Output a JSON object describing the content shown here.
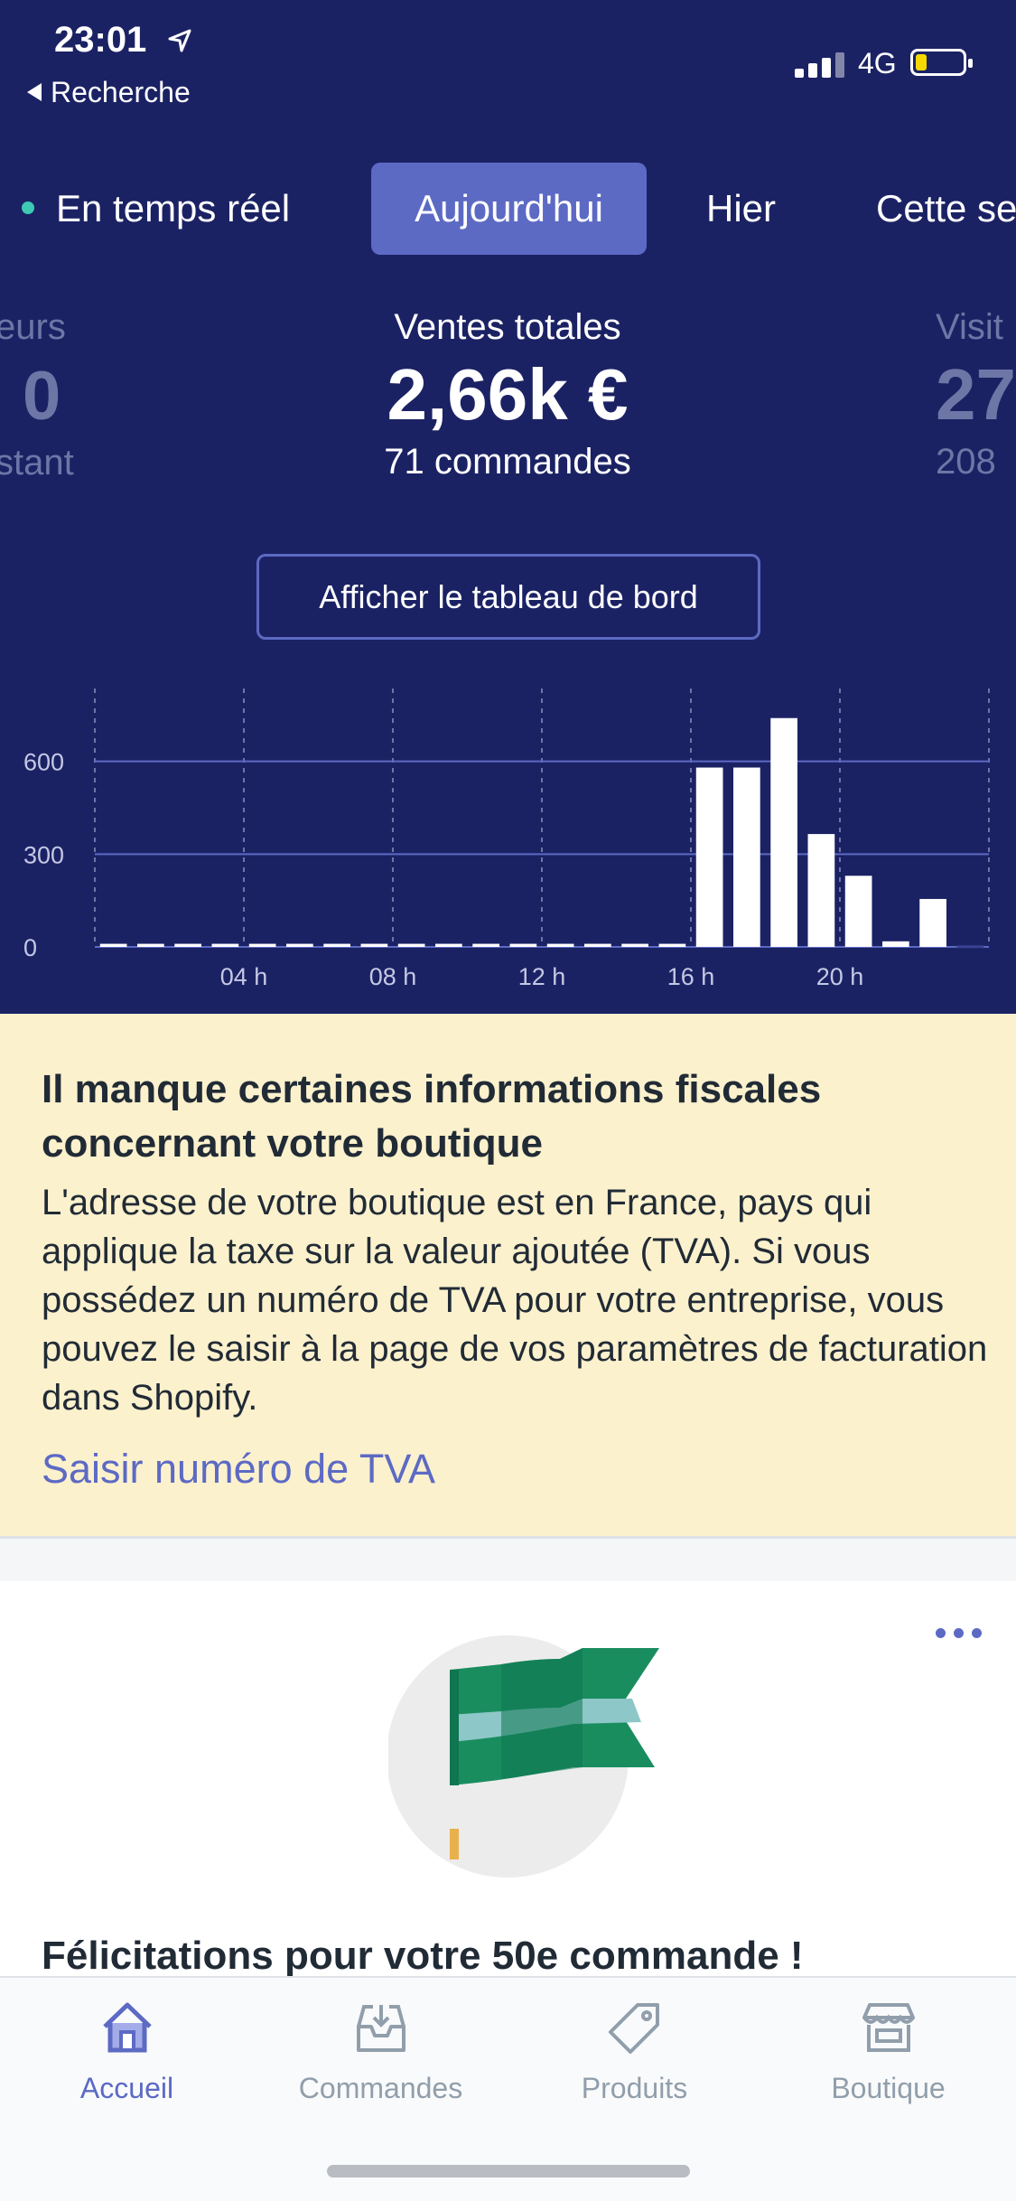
{
  "status_bar": {
    "time": "23:01",
    "back_label": "Recherche",
    "network": "4G"
  },
  "tabs": {
    "live": "En temps réel",
    "today": "Aujourd'hui",
    "yesterday": "Hier",
    "week": "Cette se"
  },
  "metrics": {
    "left": {
      "label": "eurs",
      "value": "0",
      "sub": "stant"
    },
    "center": {
      "label": "Ventes totales",
      "value": "2,66k €",
      "sub": "71 commandes"
    },
    "right": {
      "label": "Visit",
      "value": "27",
      "sub": "208"
    }
  },
  "dashboard_button": "Afficher le tableau de bord",
  "chart_data": {
    "type": "bar",
    "categories": [
      "00",
      "01",
      "02",
      "03",
      "04",
      "05",
      "06",
      "07",
      "08",
      "09",
      "10",
      "11",
      "12",
      "13",
      "14",
      "15",
      "16",
      "17",
      "18",
      "19",
      "20",
      "21",
      "22",
      "23"
    ],
    "values": [
      10,
      10,
      10,
      10,
      10,
      10,
      10,
      10,
      10,
      10,
      10,
      10,
      10,
      10,
      10,
      10,
      580,
      580,
      740,
      365,
      230,
      18,
      155,
      5
    ],
    "x_tick_labels": [
      "04 h",
      "08 h",
      "12 h",
      "16 h",
      "20 h"
    ],
    "y_tick_labels": [
      "600",
      "300",
      "0"
    ],
    "ylim": [
      0,
      900
    ],
    "grid": true
  },
  "banner": {
    "title": "Il manque certaines informations fiscales concernant votre boutique",
    "body": "L'adresse de votre boutique est en France, pays qui applique la taxe sur la valeur ajoutée (TVA). Si vous possédez un numéro de TVA pour votre entreprise, vous pouvez le saisir à la page de vos paramètres de facturation dans Shopify.",
    "link": "Saisir numéro de TVA"
  },
  "card": {
    "title": "Félicitations pour votre 50e commande !"
  },
  "tabbar": {
    "home": "Accueil",
    "orders": "Commandes",
    "products": "Produits",
    "store": "Boutique"
  },
  "colors": {
    "header_bg": "#1b2264",
    "accent": "#5c6ac4",
    "banner_bg": "#fcf1cd",
    "live_dot": "#3ec9b4"
  }
}
